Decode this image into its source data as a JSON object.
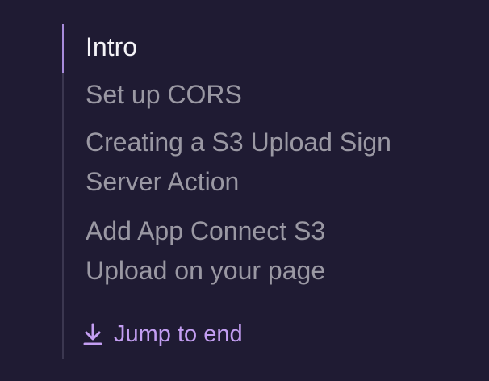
{
  "toc": {
    "items": [
      {
        "label": "Intro",
        "active": true
      },
      {
        "label": "Set up CORS",
        "active": false
      },
      {
        "label": "Creating a S3 Upload Sign Server Action",
        "active": false
      },
      {
        "label": "Add App Connect S3 Upload on your page",
        "active": false
      }
    ],
    "jump_label": "Jump to end",
    "jump_icon": "arrow-down-to-line-icon"
  },
  "colors": {
    "background": "#1f1b33",
    "active_text": "#f4f3f7",
    "inactive_text": "#9a98a3",
    "accent": "#c39ef2",
    "active_bar": "#a78bdb",
    "rail": "#3b3750"
  }
}
